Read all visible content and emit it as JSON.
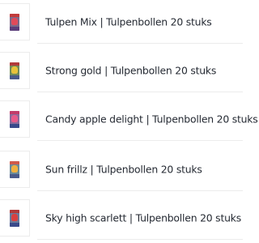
{
  "products": [
    {
      "title": "Tulpen Mix | Tulpenbollen 20 stuks",
      "package_icon": "tulip-bulb-package-icon",
      "colors": {
        "body": "#7a6a8a",
        "band": "#c23b3b",
        "flower": "#e04a5a",
        "base": "#5a3d7a"
      }
    },
    {
      "title": "Strong gold | Tulpenbollen 20 stuks",
      "package_icon": "tulip-bulb-package-icon",
      "colors": {
        "body": "#6f8a5a",
        "band": "#b23a3a",
        "flower": "#e8c23a",
        "base": "#4a5a8a"
      }
    },
    {
      "title": "Candy apple delight | Tulpenbollen 20 stuks",
      "package_icon": "tulip-bulb-package-icon",
      "colors": {
        "body": "#8a6a9a",
        "band": "#c23b6a",
        "flower": "#e85a8a",
        "base": "#3a4a8a"
      }
    },
    {
      "title": "Sun frillz | Tulpenbollen 20 stuks",
      "package_icon": "tulip-bulb-package-icon",
      "colors": {
        "body": "#6a8a9a",
        "band": "#d05a4a",
        "flower": "#f0b040",
        "base": "#4a5a8a"
      }
    },
    {
      "title": "Sky high scarlett | Tulpenbollen 20 stuks",
      "package_icon": "tulip-bulb-package-icon",
      "colors": {
        "body": "#6a7a9a",
        "band": "#b23a3a",
        "flower": "#d84040",
        "base": "#3a4a8a"
      }
    }
  ]
}
